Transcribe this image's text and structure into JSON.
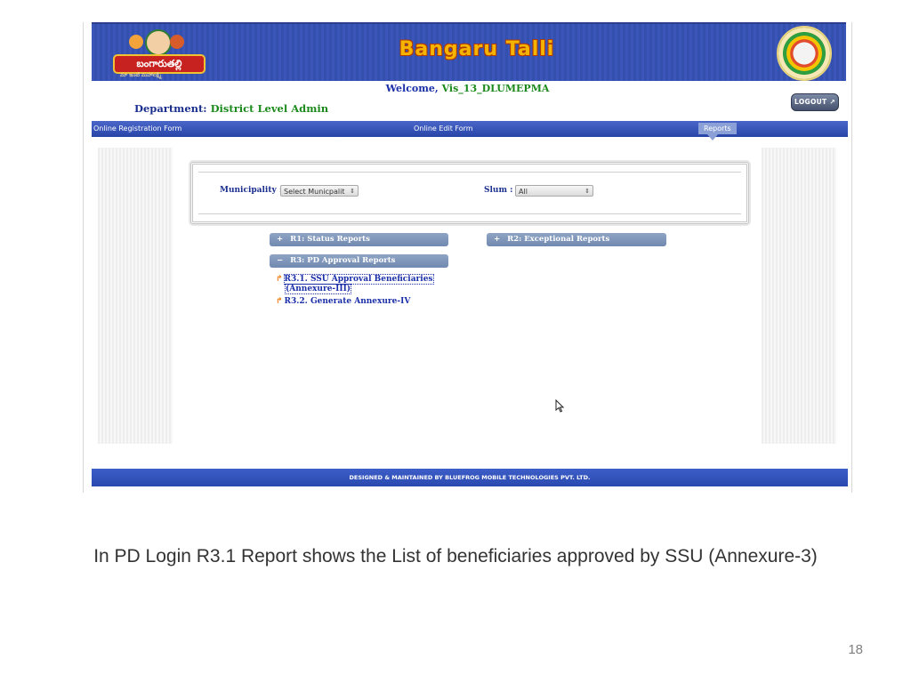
{
  "header": {
    "logo_text": "బంగారుతల్లి",
    "logo_subtext": "మా ఇంటి మహాలక్ష్మి",
    "brand_title": "Bangaru Talli"
  },
  "user": {
    "welcome_prefix": "Welcome,",
    "username": "Vis_13_DLUMEPMA",
    "department_label": "Department:",
    "department_value": "District Level Admin",
    "logout_label": "LOGOUT"
  },
  "nav": {
    "tabs": [
      {
        "label": "Online Registration Form"
      },
      {
        "label": "Online Edit Form"
      },
      {
        "label": "Reports",
        "active": true
      }
    ]
  },
  "filters": {
    "municipality_label": "Municipality :",
    "municipality_value": "Select Municpalit",
    "slum_label": "Slum :",
    "slum_value": "All"
  },
  "reports": {
    "r1": {
      "sign": "+",
      "label": "R1: Status Reports"
    },
    "r2": {
      "sign": "+",
      "label": "R2: Exceptional Reports"
    },
    "r3": {
      "sign": "−",
      "label": "R3: PD Approval Reports"
    },
    "r3_links": [
      {
        "line1": "R3.1. SSU Approval Beneficiaries",
        "line2": "(Annexure-III)"
      },
      {
        "line1": "R3.2. Generate Annexure-IV"
      }
    ]
  },
  "footer": {
    "text": "DESIGNED & MAINTAINED BY BLUEFROG MOBILE TECHNOLOGIES PVT. LTD."
  },
  "slide": {
    "caption": "In  PD Login R3.1 Report shows the List of beneficiaries approved by  SSU (Annexure-3)",
    "page_number": "18"
  },
  "colors": {
    "banner_blue": "#3350ae",
    "nav_blue": "#2645a8",
    "accordion": "#7f96bb",
    "label_blue": "#1b2f8f",
    "value_green": "#1c8a1c",
    "bullet_orange": "#f07a10"
  },
  "icons": {
    "logout": "arrow-up-right-icon",
    "bullet": "orange-arrow-icon",
    "cursor": "mouse-pointer-icon"
  }
}
